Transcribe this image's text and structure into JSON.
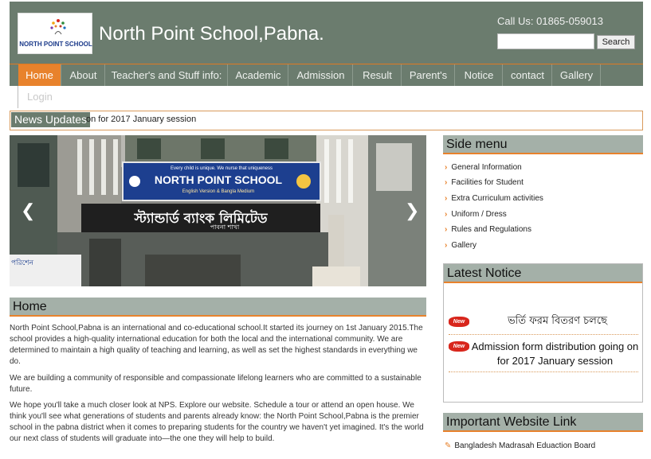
{
  "header": {
    "logo_text": "NORTH POINT SCHOOL",
    "site_title": "North Point School,Pabna.",
    "call_us": "Call Us: 01865-059013",
    "search_button": "Search",
    "search_value": ""
  },
  "nav": {
    "items": [
      {
        "label": "Home"
      },
      {
        "label": "About"
      },
      {
        "label": "Teacher's and Stuff info:"
      },
      {
        "label": "Academic"
      },
      {
        "label": "Admission"
      },
      {
        "label": "Result"
      },
      {
        "label": "Parent's"
      },
      {
        "label": "Notice"
      },
      {
        "label": "contact"
      },
      {
        "label": "Gallery"
      }
    ],
    "login": "Login"
  },
  "news": {
    "label": "News Updates",
    "text": "on for 2017 January session"
  },
  "slider": {
    "sign_title": "NORTH POINT SCHOOL",
    "sign_tagline": "Every child is unique. We nurse that uniqueness",
    "sign_sub": "English Version & Bangla Medium",
    "bank_sign": "স্ট্যান্ডার্ড ব্যাংক লিমিটেড",
    "bank_branch": "পাবনা শাখা",
    "left_sign": "পরিশেন"
  },
  "home": {
    "heading": "Home",
    "paragraphs": [
      "North Point School,Pabna is an international and co-educational school.It started its journey on 1st January 2015.The school provides a high-quality international education for both the local and the international community. We are determined to maintain a high quality of teaching and learning, as well as set the highest standards in everything we do.",
      "We are building a community of responsible and compassionate lifelong learners who are committed to a sustainable future.",
      "We hope you'll take a much closer look at NPS. Explore our website. Schedule a tour or attend an open house. We think you'll see what generations of students and parents already know: the North Point School,Pabna is the premier school in the pabna district when it comes to preparing students for the country we haven't yet imagined. It's the world our next class of students will graduate into—the one they will help to build."
    ]
  },
  "side_menu": {
    "heading": "Side menu",
    "items": [
      {
        "label": "General Information"
      },
      {
        "label": "Facilities for Student"
      },
      {
        "label": "Extra Curriculum activities"
      },
      {
        "label": "Uniform / Dress"
      },
      {
        "label": "Rules and Regulations"
      },
      {
        "label": "Gallery"
      }
    ]
  },
  "latest_notice": {
    "heading": "Latest Notice",
    "badge": "New",
    "items": [
      {
        "text": "ভর্তি ফরম বিতরণ চলছে"
      },
      {
        "text": "Admission form distribution going on for 2017 January session"
      }
    ]
  },
  "important_links": {
    "heading": "Important Website Link",
    "items": [
      {
        "label": "Bangladesh Madrasah Eduaction Board"
      }
    ]
  },
  "colors": {
    "header_bg": "#6b7c6e",
    "accent": "#e8822c",
    "section_bg": "#a4b0a8"
  }
}
